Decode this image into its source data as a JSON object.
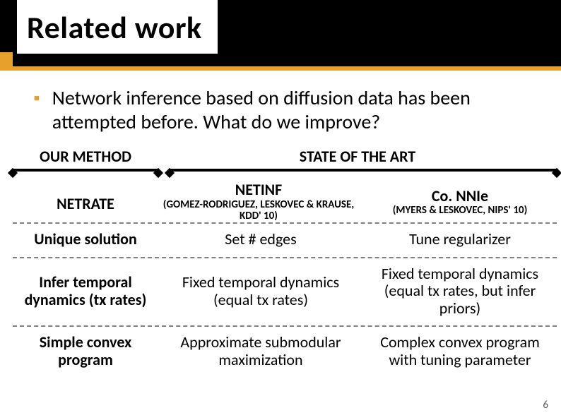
{
  "title": "Related work",
  "bullet": "Network inference based on diffusion data has been attempted before. What do we improve?",
  "colHeaders": {
    "left": "OUR METHOD",
    "right": "STATE OF THE ART"
  },
  "methods": {
    "ours": "NETRATE",
    "netinf": {
      "name": "NETINF",
      "cite": "(GOMEZ-RODRIGUEZ, LESKOVEC & KRAUSE, KDD' 10)"
    },
    "connie": {
      "name": "Co. NNIe",
      "cite": "(MYERS & LESKOVEC, NIPS' 10)"
    }
  },
  "rows": [
    {
      "a": "Unique solution",
      "b": "Set # edges",
      "c": "Tune regularizer"
    },
    {
      "a": "Infer temporal dynamics (tx rates)",
      "b": "Fixed temporal dynamics (equal tx rates)",
      "c": "Fixed temporal dynamics (equal tx rates, but infer priors)"
    },
    {
      "a": "Simple convex program",
      "b": "Approximate submodular maximization",
      "c": "Complex convex program with tuning parameter"
    }
  ],
  "pageNumber": "6"
}
